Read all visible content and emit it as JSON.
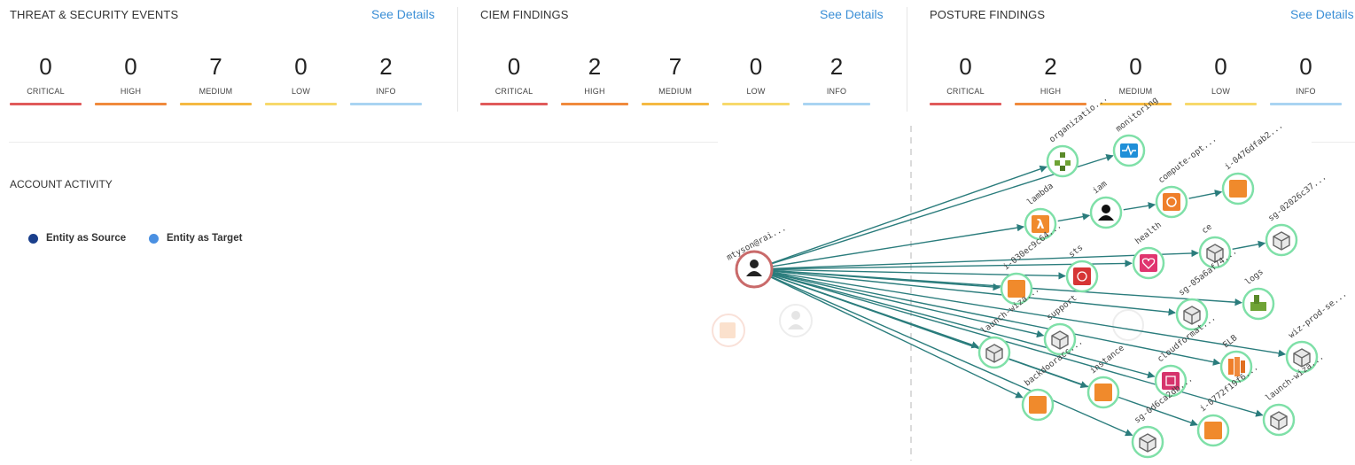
{
  "panels": [
    {
      "title": "THREAT & SECURITY EVENTS",
      "link": "See Details",
      "counts": [
        {
          "value": "0",
          "label": "CRITICAL",
          "color": "#e05a5a"
        },
        {
          "value": "0",
          "label": "HIGH",
          "color": "#f08a3c"
        },
        {
          "value": "7",
          "label": "MEDIUM",
          "color": "#f5b942"
        },
        {
          "value": "0",
          "label": "LOW",
          "color": "#f7d96b"
        },
        {
          "value": "2",
          "label": "INFO",
          "color": "#a9d4f2"
        }
      ]
    },
    {
      "title": "CIEM FINDINGS",
      "link": "See Details",
      "counts": [
        {
          "value": "0",
          "label": "CRITICAL",
          "color": "#e05a5a"
        },
        {
          "value": "2",
          "label": "HIGH",
          "color": "#f08a3c"
        },
        {
          "value": "7",
          "label": "MEDIUM",
          "color": "#f5b942"
        },
        {
          "value": "0",
          "label": "LOW",
          "color": "#f7d96b"
        },
        {
          "value": "2",
          "label": "INFO",
          "color": "#a9d4f2"
        }
      ]
    },
    {
      "title": "POSTURE FINDINGS",
      "link": "See Details",
      "counts": [
        {
          "value": "0",
          "label": "CRITICAL",
          "color": "#e05a5a"
        },
        {
          "value": "2",
          "label": "HIGH",
          "color": "#f08a3c"
        },
        {
          "value": "0",
          "label": "MEDIUM",
          "color": "#f5b942"
        },
        {
          "value": "0",
          "label": "LOW",
          "color": "#f7d96b"
        },
        {
          "value": "0",
          "label": "INFO",
          "color": "#a9d4f2"
        }
      ]
    }
  ],
  "activity": {
    "title": "ACCOUNT ACTIVITY",
    "legend": [
      {
        "label": "Entity as Source",
        "color": "#1a3f8c"
      },
      {
        "label": "Entity as Target",
        "color": "#4a90e2"
      }
    ]
  },
  "graph": {
    "source": {
      "label": "mtyson@rai..."
    },
    "nodes": [
      {
        "label": "organizatio...",
        "icon": "organizations-icon"
      },
      {
        "label": "monitoring",
        "icon": "monitoring-icon"
      },
      {
        "label": "lambda",
        "icon": "lambda-icon"
      },
      {
        "label": "iam",
        "icon": "user-icon"
      },
      {
        "label": "compute-opt...",
        "icon": "compute-optimizer-icon"
      },
      {
        "label": "i-0476dfab2...",
        "icon": "instance-icon"
      },
      {
        "label": "ce",
        "icon": "cube-icon"
      },
      {
        "label": "sg-02026c37...",
        "icon": "cube-icon"
      },
      {
        "label": "health",
        "icon": "health-icon"
      },
      {
        "label": "sts",
        "icon": "sts-icon"
      },
      {
        "label": "i-030ec9c64...",
        "icon": "instance-icon"
      },
      {
        "label": "logs",
        "icon": "logs-icon"
      },
      {
        "label": "sg-05a6af74...",
        "icon": "cube-icon"
      },
      {
        "label": "wiz-prod-se...",
        "icon": "cube-icon"
      },
      {
        "label": "support",
        "icon": "cube-icon"
      },
      {
        "label": "launch-wiza...",
        "icon": "cube-icon"
      },
      {
        "label": "ELB",
        "icon": "elb-icon"
      },
      {
        "label": "cloudformat...",
        "icon": "cloudformation-icon"
      },
      {
        "label": "instance",
        "icon": "instance-icon"
      },
      {
        "label": "backdooracc...",
        "icon": "instance-icon"
      },
      {
        "label": "launch-wiza...",
        "icon": "cube-icon"
      },
      {
        "label": "i-0772f19f6...",
        "icon": "instance-icon"
      },
      {
        "label": "sg-0d6ca2db...",
        "icon": "cube-icon"
      }
    ]
  }
}
